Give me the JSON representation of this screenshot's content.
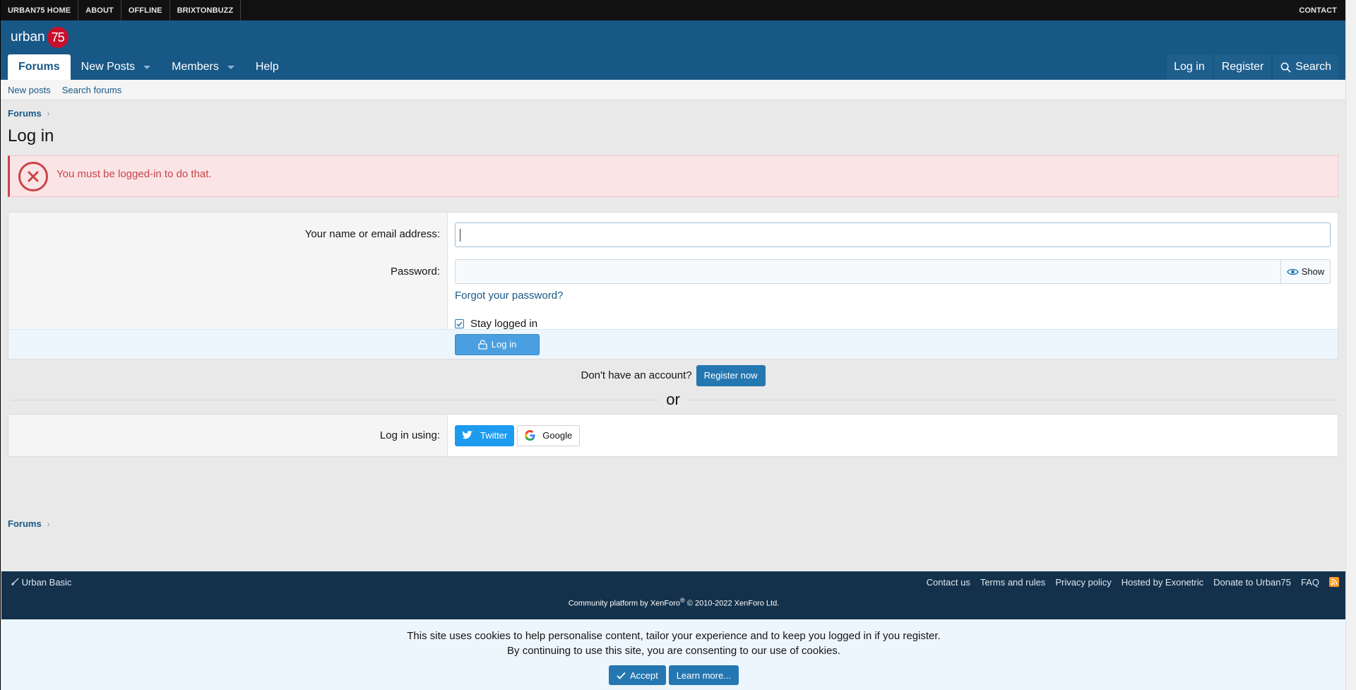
{
  "topnav": {
    "links": [
      "URBAN75 HOME",
      "ABOUT",
      "OFFLINE",
      "BRIXTONBUZZ"
    ],
    "contact": "CONTACT"
  },
  "logo": {
    "word": "urban",
    "badge": "75"
  },
  "nav": {
    "tabs": [
      {
        "label": "Forums"
      },
      {
        "label": "New Posts"
      },
      {
        "label": "Members"
      },
      {
        "label": "Help"
      }
    ],
    "login": "Log in",
    "register": "Register",
    "search": "Search"
  },
  "subnav": {
    "items": [
      "New posts",
      "Search forums"
    ]
  },
  "breadcrumb": {
    "root": "Forums"
  },
  "page": {
    "title": "Log in"
  },
  "alert": {
    "message": "You must be logged-in to do that."
  },
  "form": {
    "username_label": "Your name or email address:",
    "username_value": "",
    "password_label": "Password:",
    "password_value": "",
    "show_label": "Show",
    "forgot": "Forgot your password?",
    "stay_logged": "Stay logged in",
    "submit": "Log in"
  },
  "register": {
    "text": "Don't have an account?",
    "button": "Register now"
  },
  "or": "or",
  "social": {
    "label": "Log in using:",
    "twitter": "Twitter",
    "google": "Google"
  },
  "footer": {
    "style": "Urban Basic",
    "links": [
      "Contact us",
      "Terms and rules",
      "Privacy policy",
      "Hosted by Exonetric",
      "Donate to Urban75",
      "FAQ"
    ],
    "copy_a": "Community platform by XenForo",
    "reg": "®",
    "copy_b": " © 2010-2022 XenForo Ltd."
  },
  "cookie": {
    "line1": "This site uses cookies to help personalise content, tailor your experience and to keep you logged in if you register.",
    "line2": "By continuing to use this site, you are consenting to our use of cookies.",
    "accept": "Accept",
    "learn": "Learn more..."
  },
  "colors": {
    "header": "#185886",
    "footer": "#14314b",
    "error": "#c84448",
    "accent": "#2577b1"
  }
}
